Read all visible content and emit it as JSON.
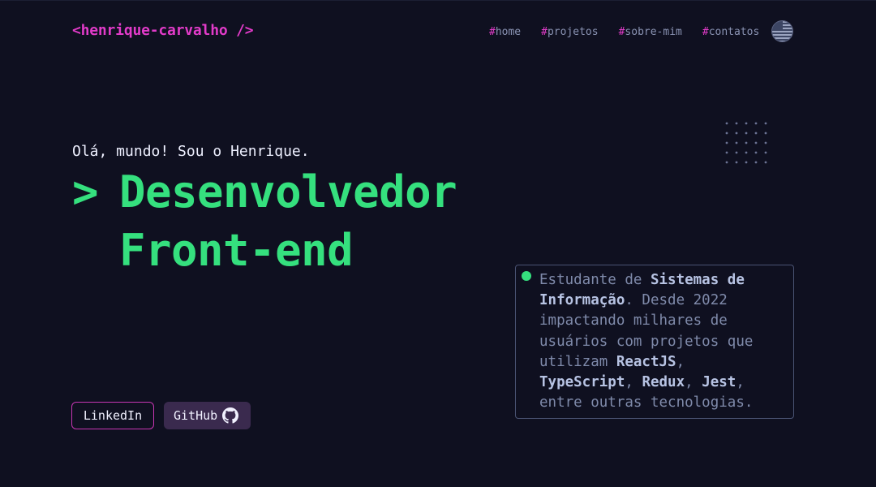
{
  "header": {
    "logo": "<henrique-carvalho />",
    "nav": [
      {
        "hash": "#",
        "label": "home"
      },
      {
        "hash": "#",
        "label": "projetos"
      },
      {
        "hash": "#",
        "label": "sobre-mim"
      },
      {
        "hash": "#",
        "label": "contatos"
      }
    ],
    "language_icon": "us-flag-icon"
  },
  "hero": {
    "greeting": "Olá, mundo! Sou o Henrique.",
    "prompt": ">",
    "role_line1": "Desenvolvedor",
    "role_line2": "Front-end"
  },
  "card": {
    "segments": [
      {
        "text": "Estudante de ",
        "bold": false
      },
      {
        "text": "Sistemas de Informação",
        "bold": true
      },
      {
        "text": ". Desde 2022 impactando milhares de usuários com projetos que utilizam ",
        "bold": false
      },
      {
        "text": "ReactJS",
        "bold": true
      },
      {
        "text": ", ",
        "bold": false
      },
      {
        "text": "TypeScript",
        "bold": true
      },
      {
        "text": ", ",
        "bold": false
      },
      {
        "text": "Redux",
        "bold": true
      },
      {
        "text": ", ",
        "bold": false
      },
      {
        "text": "Jest",
        "bold": true
      },
      {
        "text": ", entre outras tecnologias.",
        "bold": false
      }
    ]
  },
  "buttons": {
    "linkedin": "LinkedIn",
    "github": "GitHub",
    "github_icon": "github-icon"
  },
  "colors": {
    "background": "#0f1020",
    "accent_pink": "#e23bc9",
    "accent_green": "#35e07e",
    "muted_text": "#7f8aaa"
  }
}
